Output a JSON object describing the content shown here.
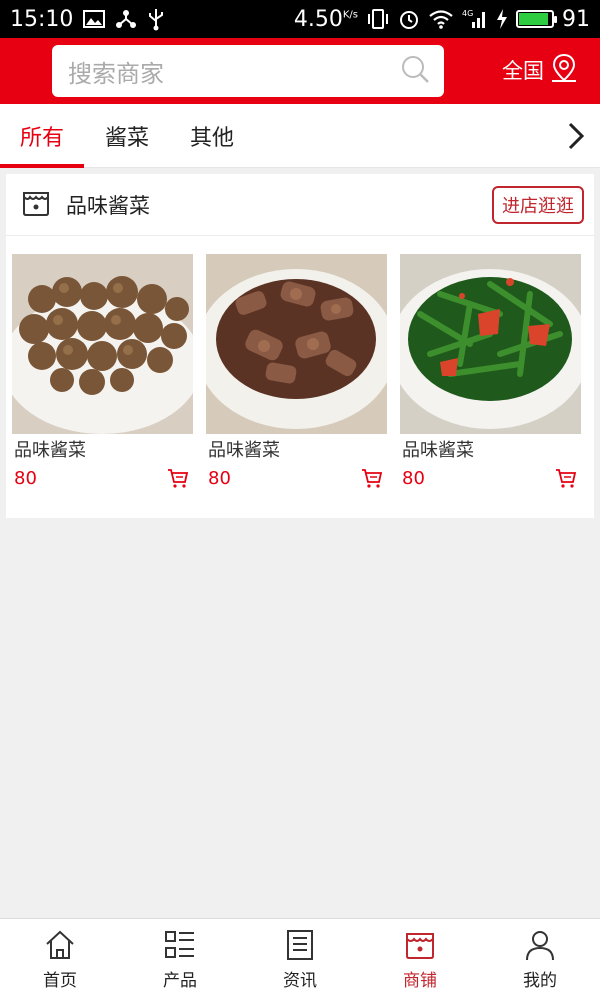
{
  "status_bar": {
    "time": "15:10",
    "speed": "4.50",
    "speed_unit": "K/s",
    "network": "4G",
    "battery": "91",
    "battery_level": 0.91
  },
  "header": {
    "search_placeholder": "搜索商家",
    "region": "全国"
  },
  "tabs": [
    {
      "label": "所有",
      "active": true
    },
    {
      "label": "酱菜",
      "active": false
    },
    {
      "label": "其他",
      "active": false
    }
  ],
  "store": {
    "name": "品味酱菜",
    "enter_label": "进店逛逛",
    "products": [
      {
        "name": "品味酱菜",
        "price": "80",
        "image": "pickled-chinese-artichoke"
      },
      {
        "name": "品味酱菜",
        "price": "80",
        "image": "braised-pickled-vegetables"
      },
      {
        "name": "品味酱菜",
        "price": "80",
        "image": "green-pickled-vegetables-with-tomato"
      }
    ]
  },
  "bottom_nav": [
    {
      "label": "首页",
      "icon": "home-icon",
      "active": false
    },
    {
      "label": "产品",
      "icon": "list-icon",
      "active": false
    },
    {
      "label": "资讯",
      "icon": "news-icon",
      "active": false
    },
    {
      "label": "商铺",
      "icon": "shop-icon",
      "active": true
    },
    {
      "label": "我的",
      "icon": "user-icon",
      "active": false
    }
  ],
  "colors": {
    "brand_red": "#e60012",
    "accent_red": "#c0262d",
    "background": "#f0f0f0"
  }
}
